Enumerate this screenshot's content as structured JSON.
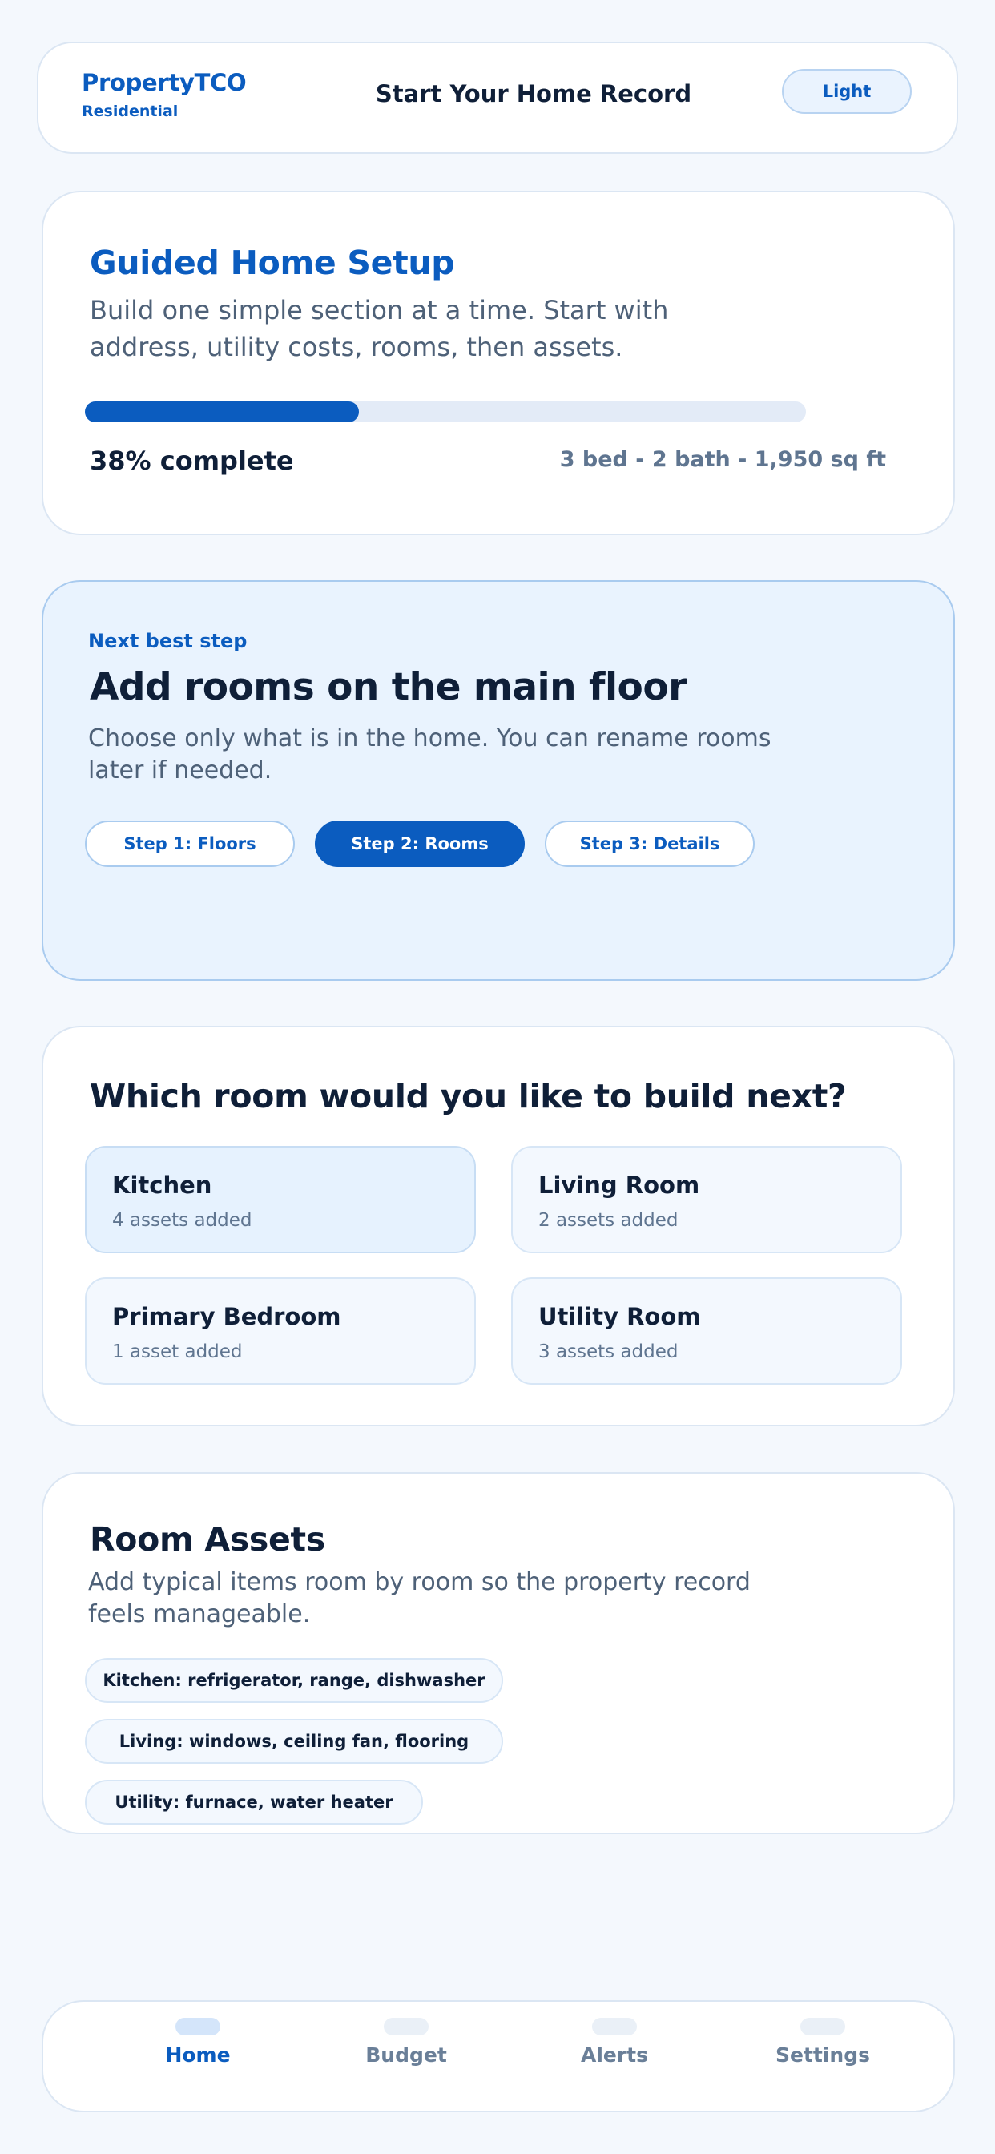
{
  "header": {
    "brand_name": "PropertyTCO",
    "brand_sub": "Residential",
    "title": "Start Your Home Record",
    "theme_label": "Light"
  },
  "setup": {
    "title": "Guided Home Setup",
    "description": "Build one simple section at a time. Start with address, utility costs, rooms, then assets.",
    "progress_percent": 38,
    "progress_label": "38% complete",
    "home_stats": "3 bed - 2 bath - 1,950 sq ft"
  },
  "next_step": {
    "kicker": "Next best step",
    "title": "Add rooms on the main floor",
    "description": "Choose only what is in the home. You can rename rooms later if needed.",
    "steps": [
      {
        "label": "Step 1: Floors",
        "active": false
      },
      {
        "label": "Step 2: Rooms",
        "active": true
      },
      {
        "label": "Step 3: Details",
        "active": false
      }
    ]
  },
  "rooms": {
    "title": "Which room would you like to build next?",
    "items": [
      {
        "name": "Kitchen",
        "count": "4 assets added",
        "selected": true
      },
      {
        "name": "Living Room",
        "count": "2 assets added",
        "selected": false
      },
      {
        "name": "Primary Bedroom",
        "count": "1 asset added",
        "selected": false
      },
      {
        "name": "Utility Room",
        "count": "3 assets added",
        "selected": false
      }
    ]
  },
  "assets": {
    "title": "Room Assets",
    "description": "Add typical items room by room so the property record feels manageable.",
    "chips": [
      "Kitchen: refrigerator, range, dishwasher",
      "Living: windows, ceiling fan, flooring",
      "Utility: furnace, water heater"
    ]
  },
  "nav": {
    "items": [
      {
        "label": "Home",
        "active": true
      },
      {
        "label": "Budget",
        "active": false
      },
      {
        "label": "Alerts",
        "active": false
      },
      {
        "label": "Settings",
        "active": false
      }
    ]
  },
  "colors": {
    "accent": "#0b5cbf",
    "background": "#f4f8fd",
    "highlight_card": "#e9f3fe"
  }
}
